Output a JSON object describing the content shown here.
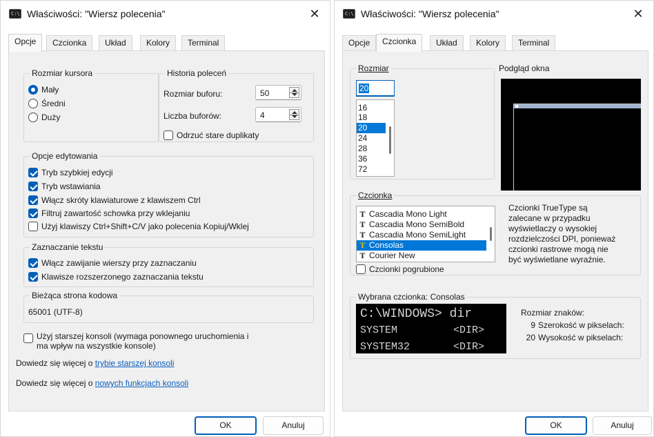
{
  "left_window": {
    "title": "Właściwości: \"Wiersz polecenia\"",
    "close_glyph": "✕",
    "tabs": [
      "Opcje",
      "Czcionka",
      "Układ",
      "Kolory",
      "Terminal"
    ],
    "active_tab": "Opcje",
    "cursor_size": {
      "title": "Rozmiar kursora",
      "options": [
        "Mały",
        "Średni",
        "Duży"
      ],
      "selected": "Mały"
    },
    "history": {
      "title": "Historia poleceń",
      "buffer_size_label": "Rozmiar buforu:",
      "buffer_size_value": "50",
      "buffer_count_label": "Liczba buforów:",
      "buffer_count_value": "4",
      "discard_duplicates_label": "Odrzuć stare duplikaty",
      "discard_duplicates_checked": false
    },
    "edit_options": {
      "title": "Opcje edytowania",
      "items": [
        {
          "label": "Tryb szybkiej edycji",
          "checked": true
        },
        {
          "label": "Tryb wstawiania",
          "checked": true
        },
        {
          "label": "Włącz skróty klawiaturowe z klawiszem Ctrl",
          "checked": true
        },
        {
          "label": "Filtruj zawartość schowka przy wklejaniu",
          "checked": true
        },
        {
          "label": "Użyj klawiszy Ctrl+Shift+C/V jako polecenia Kopiuj/Wklej",
          "checked": false
        }
      ]
    },
    "text_selection": {
      "title": "Zaznaczanie tekstu",
      "items": [
        {
          "label": "Włącz zawijanie wierszy przy zaznaczaniu",
          "checked": true
        },
        {
          "label": "Klawisze rozszerzonego zaznaczania tekstu",
          "checked": true
        }
      ]
    },
    "codepage": {
      "title": "Bieżąca strona kodowa",
      "value": "65001 (UTF-8)"
    },
    "legacy_console": {
      "line1": "Użyj starszej konsoli (wymaga ponownego uruchomienia i",
      "line2": "ma wpływ na wszystkie konsole)",
      "checked": false
    },
    "learn_more_legacy": {
      "prefix": "Dowiedz się więcej o ",
      "link": "trybie starszej konsoli"
    },
    "learn_more_new": {
      "prefix": "Dowiedz się więcej o ",
      "link": "nowych funkcjach konsoli"
    },
    "ok_label": "OK",
    "cancel_label": "Anuluj"
  },
  "right_window": {
    "title": "Właściwości: \"Wiersz polecenia\"",
    "close_glyph": "✕",
    "tabs": [
      "Opcje",
      "Czcionka",
      "Układ",
      "Kolory",
      "Terminal"
    ],
    "active_tab": "Czcionka",
    "size": {
      "title": "Rozmiar",
      "input_value": "20",
      "list": [
        "16",
        "18",
        "20",
        "24",
        "28",
        "36",
        "72"
      ],
      "selected": "20"
    },
    "window_preview_title": "Podgląd okna",
    "font": {
      "title": "Czcionka",
      "list": [
        "Cascadia Mono Light",
        "Cascadia Mono SemiBold",
        "Cascadia Mono SemiLight",
        "Consolas",
        "Courier New"
      ],
      "selected": "Consolas",
      "tt_glyph": "T",
      "bold_label": "Czcionki pogrubione",
      "bold_checked": false,
      "info_lines": [
        "Czcionki TrueType są",
        "zalecane w przypadku",
        "wyświetlaczy o wysokiej",
        "rozdzielczości DPI, ponieważ",
        "czcionki rastrowe mogą nie",
        "być wyświetlane wyraźnie."
      ]
    },
    "selected_font": {
      "title": "Wybrana czcionka: Consolas",
      "sample_lines": [
        "C:\\WINDOWS> dir",
        "SYSTEM         <DIR>",
        "SYSTEM32       <DIR>"
      ],
      "char_size_title": "Rozmiar znaków:",
      "width_value": "9",
      "width_label": "Szerokość w pikselach:",
      "height_value": "20",
      "height_label": "Wysokość w pikselach:"
    },
    "ok_label": "OK",
    "cancel_label": "Anuluj"
  },
  "colors": {
    "accent": "#005fb8",
    "link": "#0a5fc0",
    "selection": "#0078d7",
    "panel": "#f0f0f0",
    "console_bg": "#000000"
  }
}
